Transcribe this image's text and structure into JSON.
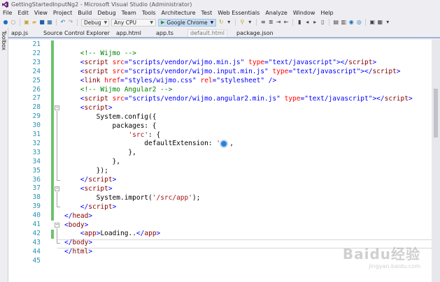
{
  "window": {
    "title": "GettingStartedInputNg2 - Microsoft Visual Studio (Administrator)"
  },
  "menu": [
    "File",
    "Edit",
    "View",
    "Project",
    "Build",
    "Debug",
    "Team",
    "Tools",
    "Architecture",
    "Test",
    "Web Essentials",
    "Analyze",
    "Window",
    "Help"
  ],
  "toolbar": {
    "config": "Debug",
    "platform": "Any CPU",
    "browser": "Google Chrome"
  },
  "sidebar": {
    "toolbox": "Toolbox"
  },
  "tabs": [
    {
      "label": "app.js",
      "active": false
    },
    {
      "label": "Source Control Explorer",
      "active": false
    },
    {
      "label": "app.html",
      "active": false
    },
    {
      "label": "app.ts",
      "active": false
    },
    {
      "label": "default.html",
      "active": true
    },
    {
      "label": "package.json",
      "active": false
    }
  ],
  "editor": {
    "line_numbers": [
      "21",
      "22",
      "23",
      "24",
      "25",
      "26",
      "27",
      "28",
      "29",
      "30",
      "31",
      "32",
      "33",
      "34",
      "35",
      "36",
      "37",
      "38",
      "39",
      "40",
      "41",
      "42",
      "43",
      "44",
      "45"
    ],
    "lines": [
      [],
      [
        [
          "c",
          "<!-- Wijmo -->"
        ]
      ],
      [
        [
          "b",
          "<"
        ],
        [
          "t",
          "script"
        ],
        [
          "s",
          " "
        ],
        [
          "a",
          "src"
        ],
        [
          "b",
          "=\""
        ],
        [
          "v",
          "scripts/vendor/wijmo.min.js"
        ],
        [
          "b",
          "\""
        ],
        [
          "s",
          " "
        ],
        [
          "a",
          "type"
        ],
        [
          "b",
          "=\""
        ],
        [
          "v",
          "text/javascript"
        ],
        [
          "b",
          "\"></"
        ],
        [
          "t",
          "script"
        ],
        [
          "b",
          ">"
        ]
      ],
      [
        [
          "b",
          "<"
        ],
        [
          "t",
          "script"
        ],
        [
          "s",
          " "
        ],
        [
          "a",
          "src"
        ],
        [
          "b",
          "=\""
        ],
        [
          "v",
          "scripts/vendor/wijmo.input.min.js"
        ],
        [
          "b",
          "\""
        ],
        [
          "s",
          " "
        ],
        [
          "a",
          "type"
        ],
        [
          "b",
          "=\""
        ],
        [
          "v",
          "text/javascript"
        ],
        [
          "b",
          "\"></"
        ],
        [
          "t",
          "script"
        ],
        [
          "b",
          ">"
        ]
      ],
      [
        [
          "b",
          "<"
        ],
        [
          "t",
          "link"
        ],
        [
          "s",
          " "
        ],
        [
          "a",
          "href"
        ],
        [
          "b",
          "=\""
        ],
        [
          "v",
          "styles/wijmo.css"
        ],
        [
          "b",
          "\""
        ],
        [
          "s",
          " "
        ],
        [
          "a",
          "rel"
        ],
        [
          "b",
          "=\""
        ],
        [
          "v",
          "stylesheet"
        ],
        [
          "b",
          "\""
        ],
        [
          "s",
          " "
        ],
        [
          "b",
          "/>"
        ]
      ],
      [
        [
          "c",
          "<!-- Wijmo Angular2 -->"
        ]
      ],
      [
        [
          "b",
          "<"
        ],
        [
          "t",
          "script"
        ],
        [
          "s",
          " "
        ],
        [
          "a",
          "src"
        ],
        [
          "b",
          "=\""
        ],
        [
          "v",
          "scripts/vendor/wijmo.angular2.min.js"
        ],
        [
          "b",
          "\""
        ],
        [
          "s",
          " "
        ],
        [
          "a",
          "type"
        ],
        [
          "b",
          "=\""
        ],
        [
          "v",
          "text/javascript"
        ],
        [
          "b",
          "\"></"
        ],
        [
          "t",
          "script"
        ],
        [
          "b",
          ">"
        ]
      ],
      [
        [
          "b",
          "<"
        ],
        [
          "t",
          "script"
        ],
        [
          "b",
          ">"
        ]
      ],
      [
        [
          "j",
          "    System.config({"
        ]
      ],
      [
        [
          "j",
          "        packages: {"
        ]
      ],
      [
        [
          "j",
          "            "
        ],
        [
          "r",
          "'src'"
        ],
        [
          "j",
          ": {"
        ]
      ],
      [
        [
          "j",
          "                defaultExtension: "
        ],
        [
          "r",
          "'"
        ]
      ],
      [
        [
          "j",
          "            },"
        ]
      ],
      [
        [
          "j",
          "        },"
        ]
      ],
      [
        [
          "j",
          "    });"
        ]
      ],
      [
        [
          "b",
          "</"
        ],
        [
          "t",
          "script"
        ],
        [
          "b",
          ">"
        ]
      ],
      [
        [
          "b",
          "<"
        ],
        [
          "t",
          "script"
        ],
        [
          "b",
          ">"
        ]
      ],
      [
        [
          "j",
          "    System.import("
        ],
        [
          "r",
          "'/src/app'"
        ],
        [
          "j",
          ");"
        ]
      ],
      [
        [
          "b",
          "</"
        ],
        [
          "t",
          "script"
        ],
        [
          "b",
          ">"
        ]
      ],
      [
        [
          "b",
          "</"
        ],
        [
          "t",
          "head"
        ],
        [
          "b",
          ">"
        ]
      ],
      [
        [
          "b",
          "<"
        ],
        [
          "t",
          "body"
        ],
        [
          "b",
          ">"
        ]
      ],
      [
        [
          "b",
          "<"
        ],
        [
          "t",
          "app"
        ],
        [
          "b",
          ">"
        ],
        [
          "x",
          "Loading.."
        ],
        [
          "b",
          "</"
        ],
        [
          "t",
          "app"
        ],
        [
          "b",
          ">"
        ]
      ],
      [
        [
          "b",
          "</"
        ],
        [
          "t",
          "body"
        ],
        [
          "b",
          ">"
        ]
      ],
      [
        [
          "b",
          "</"
        ],
        [
          "t",
          "html"
        ],
        [
          "b",
          ">"
        ]
      ],
      []
    ]
  },
  "watermark": {
    "main": "Baidu经验",
    "sub": "jingyan.baidu.com"
  }
}
